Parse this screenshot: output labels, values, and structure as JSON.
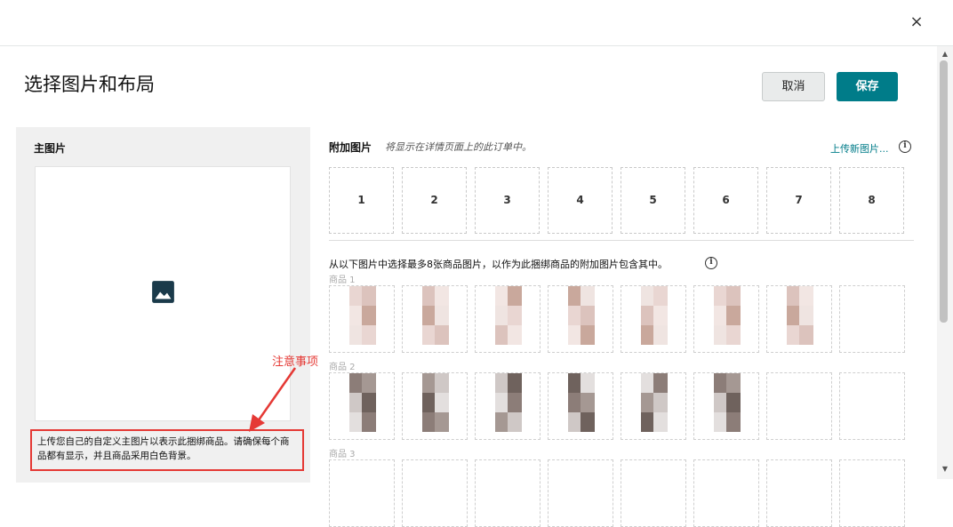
{
  "header": {
    "close_glyph": "×",
    "title": "选择图片和布局",
    "cancel_label": "取消",
    "save_label": "保存"
  },
  "main_image": {
    "title": "主图片",
    "note": "上传您自己的自定义主图片以表示此捆绑商品。请确保每个商品都有显示，并且商品采用白色背景。",
    "annotation": "注意事项",
    "icon": "image-icon"
  },
  "extra_images": {
    "title": "附加图片",
    "subtitle": "将显示在详情页面上的此订单中。",
    "upload_link": "上传新图片...",
    "slots": [
      "1",
      "2",
      "3",
      "4",
      "5",
      "6",
      "7",
      "8"
    ],
    "select_text": "从以下图片中选择最多8张商品图片，以作为此捆绑商品的附加图片包含其中。",
    "info_glyph": "i"
  },
  "products": [
    {
      "label": "商品 1"
    },
    {
      "label": "商品 2"
    },
    {
      "label": "商品 3"
    }
  ],
  "colors": {
    "accent": "#007c89",
    "annotation_red": "#e53935"
  }
}
